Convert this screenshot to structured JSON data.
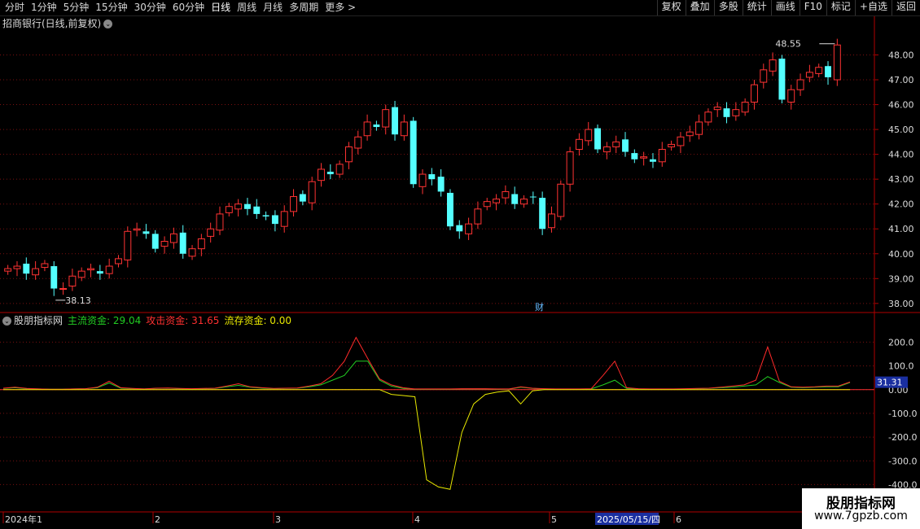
{
  "toolbar": {
    "periods": [
      "分时",
      "1分钟",
      "5分钟",
      "15分钟",
      "30分钟",
      "60分钟",
      "日线",
      "周线",
      "月线",
      "多周期",
      "更多 >"
    ],
    "active_period": "日线",
    "buttons": [
      "复权",
      "叠加",
      "多股",
      "统计",
      "画线",
      "F10",
      "+自选",
      "返回"
    ],
    "extra_button": "标记"
  },
  "stock": {
    "title": "招商银行(日线,前复权)",
    "high_label": "48.55",
    "low_label": "38.13",
    "finance_marker": "财"
  },
  "indicator": {
    "name": "股朋指标网",
    "main_label": "主流资金: 29.04",
    "attack_label": "攻击资金: 31.65",
    "stock_label": "流存资金: 0.00",
    "current_value": "31.31"
  },
  "time_axis": {
    "labels": [
      "2024年1",
      "2",
      "3",
      "4",
      "5",
      "6"
    ],
    "cursor_date": "2025/05/15/四"
  },
  "watermark": {
    "line1": "股朋指标网",
    "line2": "www.7gpzb.com"
  },
  "colors": {
    "up": "#ff3333",
    "down": "#54ffff",
    "grid": "#7a1010",
    "axis": "#b00000",
    "main_fund": "#22cc22",
    "attack_fund": "#ff2a2a",
    "stock_fund": "#e8e800"
  },
  "chart_data": [
    {
      "type": "candlestick",
      "ylim": [
        37.7,
        48.9
      ],
      "yticks": [
        "48.00",
        "47.00",
        "46.00",
        "45.00",
        "44.00",
        "43.00",
        "42.00",
        "41.00",
        "40.00",
        "39.00",
        "38.00"
      ],
      "close_path": [
        39.4,
        39.5,
        39.2,
        39.4,
        39.6,
        38.6,
        38.6,
        39.1,
        39.3,
        39.4,
        39.2,
        39.5,
        39.8,
        40.9,
        41.0,
        40.8,
        40.2,
        40.5,
        40.8,
        40.0,
        40.2,
        40.6,
        41.0,
        41.6,
        41.9,
        42.0,
        41.8,
        41.6,
        41.5,
        41.2,
        41.7,
        42.3,
        42.1,
        42.9,
        43.4,
        43.2,
        43.6,
        44.3,
        44.7,
        45.3,
        45.1,
        45.8,
        44.8,
        45.3,
        42.8,
        43.2,
        43.0,
        42.5,
        41.1,
        40.9,
        41.2,
        41.8,
        42.1,
        42.2,
        42.5,
        42.0,
        42.2,
        42.3,
        41.0,
        41.6,
        42.8,
        44.1,
        44.6,
        45.0,
        44.2,
        44.3,
        44.5,
        44.1,
        43.8,
        43.9,
        43.7,
        44.2,
        44.4,
        44.7,
        44.9,
        45.3,
        45.7,
        45.9,
        45.5,
        45.8,
        46.1,
        46.8,
        47.4,
        47.8,
        46.2,
        46.6,
        47.0,
        47.3,
        47.5,
        47.1,
        48.4
      ],
      "x_count": 91
    },
    {
      "type": "line",
      "ylim": [
        -450,
        270
      ],
      "yticks": [
        "200.0",
        "100.0",
        "0.00",
        "-100.0",
        "-200.0",
        "-300.0",
        "-400.0"
      ],
      "series": [
        {
          "name": "主流资金",
          "values": [
            5,
            8,
            4,
            3,
            2,
            2,
            3,
            4,
            8,
            28,
            6,
            4,
            3,
            5,
            6,
            4,
            3,
            4,
            5,
            12,
            18,
            10,
            6,
            4,
            5,
            6,
            12,
            20,
            40,
            60,
            120,
            120,
            40,
            15,
            5,
            2,
            2,
            2,
            2,
            3,
            3,
            3,
            2,
            2,
            10,
            5,
            3,
            2,
            2,
            2,
            3,
            20,
            40,
            5,
            3,
            2,
            2,
            2,
            3,
            4,
            5,
            8,
            10,
            15,
            20,
            55,
            30,
            10,
            8,
            10,
            12,
            12,
            30
          ]
        },
        {
          "name": "攻击资金",
          "values": [
            6,
            10,
            5,
            3,
            2,
            2,
            3,
            4,
            10,
            35,
            8,
            5,
            3,
            6,
            7,
            5,
            4,
            5,
            6,
            15,
            25,
            12,
            8,
            5,
            6,
            7,
            15,
            25,
            60,
            120,
            220,
            130,
            45,
            20,
            8,
            3,
            3,
            3,
            3,
            4,
            4,
            4,
            3,
            3,
            12,
            6,
            4,
            3,
            3,
            3,
            4,
            60,
            120,
            8,
            4,
            3,
            3,
            3,
            4,
            5,
            6,
            10,
            15,
            20,
            40,
            180,
            35,
            12,
            10,
            12,
            15,
            15,
            32
          ]
        },
        {
          "name": "流存资金",
          "values": [
            0,
            0,
            0,
            0,
            0,
            0,
            0,
            0,
            0,
            0,
            0,
            0,
            0,
            0,
            0,
            0,
            0,
            0,
            0,
            0,
            0,
            0,
            0,
            0,
            0,
            0,
            0,
            0,
            0,
            0,
            0,
            0,
            0,
            -20,
            -25,
            -30,
            -380,
            -410,
            -420,
            -180,
            -60,
            -20,
            -10,
            -5,
            -60,
            -5,
            0,
            0,
            0,
            0,
            0,
            0,
            0,
            0,
            0,
            0,
            0,
            0,
            0,
            0,
            0,
            0,
            0,
            0,
            0,
            0,
            0,
            0,
            0,
            0,
            0,
            0,
            0
          ]
        }
      ]
    }
  ]
}
